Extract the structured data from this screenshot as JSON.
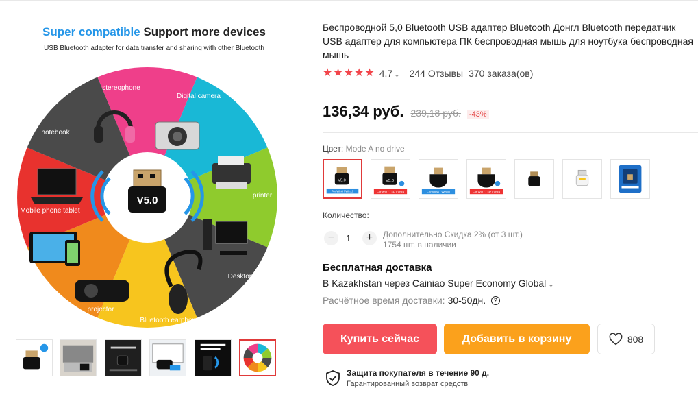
{
  "gallery": {
    "headline_part1": "Super compatible",
    "headline_part2": "Support more devices",
    "subheadline": "USB Bluetooth adapter for data transfer and sharing with other Bluetooth",
    "center_label": "V5.0",
    "segments": [
      {
        "label": "stereophone",
        "color": "#ef3f8a"
      },
      {
        "label": "Digital camera",
        "color": "#19b8d6"
      },
      {
        "label": "printer",
        "color": "#8fcb2d"
      },
      {
        "label": "Desktop",
        "color": "#4a4a4a"
      },
      {
        "label": "Bluetooth earphone",
        "color": "#f7c51e"
      },
      {
        "label": "projector",
        "color": "#f08a1c"
      },
      {
        "label": "Mobile phone tablet",
        "color": "#e8322e"
      },
      {
        "label": "notebook",
        "color": "#4a4a4a"
      }
    ],
    "thumbnail_count": 6,
    "active_thumbnail": 6
  },
  "product": {
    "title": "Беспроводной 5,0 Bluetooth USB адаптер Bluetooth Донгл Bluetooth передатчик USB адаптер для компьютера ПК беспроводная мышь для ноутбука беспроводная мышь",
    "rating": "4.7",
    "stars": 5,
    "reviews": "244 Отзывы",
    "orders": "370 заказа(ов)",
    "price": "136,34 руб.",
    "old_price": "239,18 руб.",
    "discount": "-43%",
    "accent_color": "#f5515a"
  },
  "options": {
    "color_label": "Цвет:",
    "color_value": "Mode A no drive",
    "variant_count": 7,
    "selected_variant": 1,
    "variant_tags": [
      "For Win8 / Win10",
      "For Win7 / XP / Vista",
      "For Win8 / Win10",
      "For Win7 / XP / Vista"
    ],
    "variant_label": "V5.0"
  },
  "quantity": {
    "label": "Количество:",
    "minus": "−",
    "value": "1",
    "plus": "+",
    "discount_note": "Дополнительно Скидка 2% (от 3 шт.)",
    "stock": "1754 шт. в наличии"
  },
  "shipping": {
    "title": "Бесплатная доставка",
    "route": "В Kazakhstan через Cainiao Super Economy Global",
    "eta_label": "Расчётное время доставки:",
    "eta_value": "30-50дн.",
    "help": "?"
  },
  "actions": {
    "buy": "Купить сейчас",
    "cart": "Добавить в корзину",
    "wishlist_count": "808",
    "buy_color": "#f5515a",
    "cart_color": "#fba11c"
  },
  "protection": {
    "title": "Защита покупателя в течение 90 д.",
    "subtitle": "Гарантированный возврат средств"
  }
}
